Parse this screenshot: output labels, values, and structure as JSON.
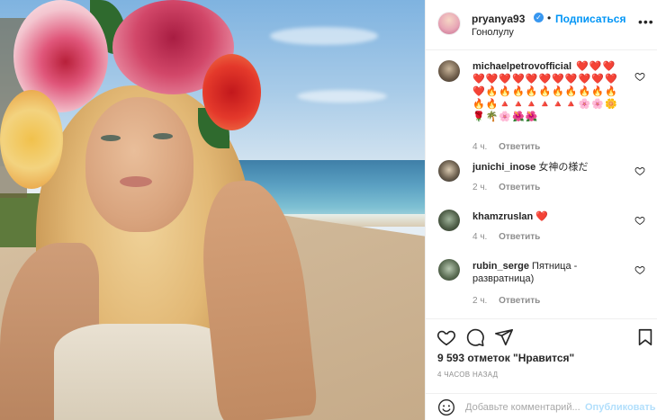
{
  "post": {
    "author": {
      "username": "pryanya93",
      "verified": true,
      "follow_label": "Подписаться",
      "location": "Гонолулу"
    },
    "comments": [
      {
        "username": "michaelpetrovofficial",
        "emoji_rows": [
          [
            "❤️",
            "❤️",
            "❤️"
          ],
          [
            "❤️",
            "❤️",
            "❤️",
            "❤️",
            "❤️",
            "❤️",
            "❤️",
            "❤️",
            "❤️",
            "❤️",
            "❤️"
          ],
          [
            "❤️",
            "🔥",
            "🔥",
            "🔥",
            "🔥",
            "🔥",
            "🔥",
            "🔥",
            "🔥",
            "🔥",
            "🔥"
          ],
          [
            "🔥",
            "🔥",
            "🔺",
            "🔺",
            "🔺",
            "🔺",
            "🔺",
            "🔺",
            "🌸",
            "🌸",
            "🌼"
          ],
          [
            "🌹",
            "🌴",
            "🌸",
            "🌺",
            "🌺"
          ]
        ],
        "time": "4 ч.",
        "reply_label": "Ответить"
      },
      {
        "username": "junichi_inose",
        "text": "女神の様だ",
        "time": "2 ч.",
        "reply_label": "Ответить"
      },
      {
        "username": "khamzruslan",
        "text": "❤️",
        "time": "4 ч.",
        "reply_label": "Ответить"
      },
      {
        "username": "rubin_serge",
        "text": "Пятница - развратница)",
        "time": "2 ч.",
        "reply_label": "Ответить"
      }
    ],
    "likes_text": "9 593 отметок \"Нравится\"",
    "posted_ago": "4 часов назад",
    "add_comment": {
      "placeholder": "Добавьте комментарий...",
      "publish_label": "Опубликовать"
    }
  },
  "colors": {
    "accent": "#0095f6",
    "verified": "#3897f0",
    "muted": "#8e8e8e",
    "publish_disabled": "#b2dffc"
  }
}
